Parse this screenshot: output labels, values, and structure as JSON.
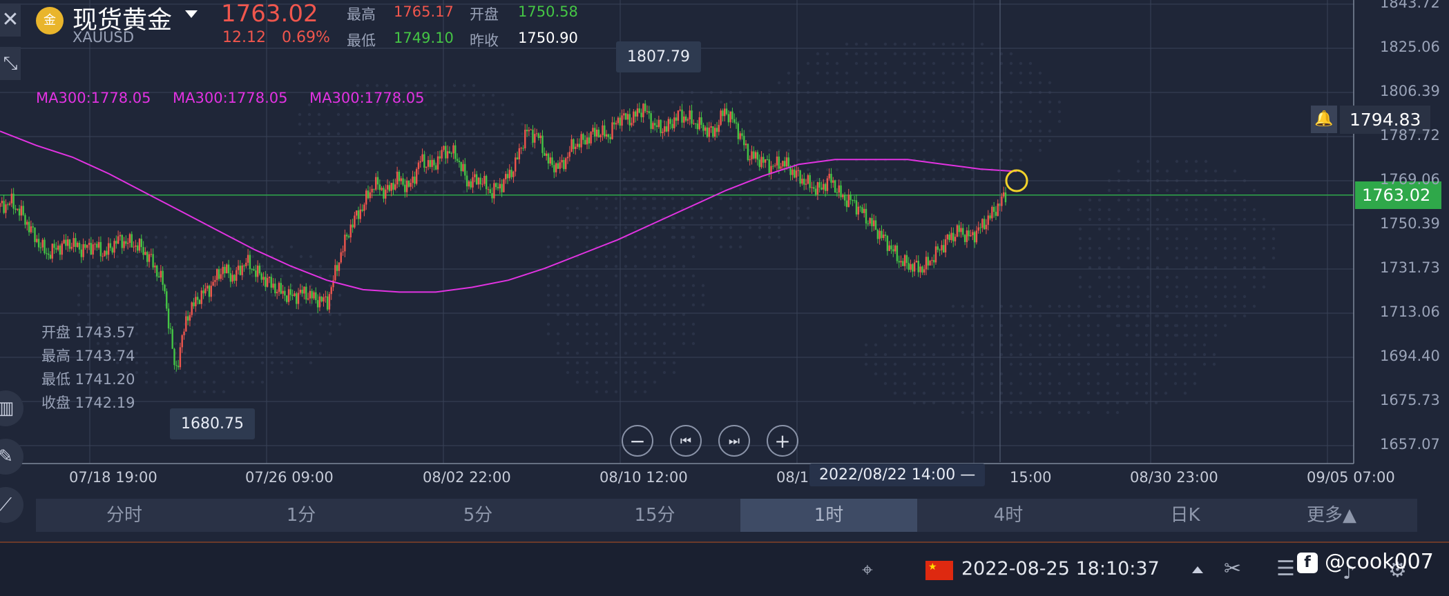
{
  "header": {
    "name": "现货黄金",
    "code": "XAUUSD",
    "price": "1763.02",
    "change": "12.12",
    "change_pct": "0.69%",
    "high_label": "最高",
    "high": "1765.17",
    "open_label": "开盘",
    "open": "1750.58",
    "low_label": "最低",
    "low": "1749.10",
    "prev_close_label": "昨收",
    "prev_close": "1750.90"
  },
  "ma_labels": [
    "MA300:1778.05",
    "MA300:1778.05",
    "MA300:1778.05"
  ],
  "ohlc_info": {
    "open": "开盘 1743.57",
    "high": "最高 1743.74",
    "low": "最低 1741.20",
    "close": "收盘 1742.19"
  },
  "callouts": {
    "max_price": "1807.79",
    "min_price": "1680.75",
    "current_price": "1763.02",
    "alert_price": "1794.83",
    "crosshair_time": "2022/08/22 14:00 —"
  },
  "y_ticks": [
    "1843.72",
    "1825.06",
    "1806.39",
    "1787.72",
    "1769.06",
    "1750.39",
    "1731.73",
    "1713.06",
    "1694.40",
    "1675.73",
    "1657.07"
  ],
  "x_ticks": [
    "07/18 19:00",
    "07/26 09:00",
    "08/02 22:00",
    "08/10 12:00",
    "08/1",
    "15:00",
    "08/30 23:00",
    "09/05 07:00"
  ],
  "chart_data": {
    "type": "candlestick",
    "interval": "1时",
    "ylim": [
      1657.07,
      1843.72
    ],
    "ma_period": 300,
    "ma_value": 1778.05,
    "max_marked": 1807.79,
    "min_marked": 1680.75,
    "last": 1763.02,
    "price_path": [
      1758,
      1760,
      1754,
      1745,
      1738,
      1741,
      1743,
      1740,
      1742,
      1738,
      1744,
      1743,
      1741,
      1735,
      1725,
      1688,
      1712,
      1720,
      1724,
      1732,
      1728,
      1735,
      1730,
      1726,
      1722,
      1720,
      1722,
      1719,
      1718,
      1736,
      1750,
      1758,
      1768,
      1764,
      1770,
      1766,
      1778,
      1775,
      1782,
      1780,
      1768,
      1770,
      1764,
      1768,
      1775,
      1790,
      1788,
      1776,
      1775,
      1784,
      1786,
      1790,
      1788,
      1796,
      1795,
      1800,
      1792,
      1791,
      1797,
      1795,
      1792,
      1789,
      1799,
      1792,
      1780,
      1778,
      1775,
      1777,
      1772,
      1768,
      1765,
      1770,
      1762,
      1760,
      1754,
      1748,
      1742,
      1735,
      1733,
      1732,
      1738,
      1744,
      1748,
      1745,
      1750,
      1756,
      1763
    ],
    "ma_path": [
      1790,
      1784,
      1779,
      1772,
      1764,
      1756,
      1748,
      1740,
      1733,
      1727,
      1723,
      1722,
      1722,
      1724,
      1727,
      1732,
      1738,
      1744,
      1751,
      1758,
      1765,
      1771,
      1776,
      1778,
      1778,
      1778,
      1776,
      1774,
      1773
    ]
  },
  "tabs": [
    "分时",
    "1分",
    "5分",
    "15分",
    "1时",
    "4时",
    "日K",
    "更多▲"
  ],
  "active_tab": "1时",
  "controls": {
    "zoom_out": "−",
    "prev": "⏮",
    "next": "⏭",
    "zoom_in": "+"
  },
  "status": {
    "datetime": "2022-08-25 18:10:37",
    "watermark": "@cook007"
  },
  "colors": {
    "background": "#1f2638",
    "up": "#f0564d",
    "down": "#45c545",
    "ma": "#e233e2",
    "last_price_line": "#2fa84a"
  },
  "icons": [
    "close-icon",
    "collapse-icon",
    "gold-coin-icon",
    "dropdown-arrow-icon",
    "bell-icon",
    "candlestick-icon",
    "pencil-icon",
    "indicator-icon",
    "cursor-icon",
    "china-flag-icon",
    "tools-icon",
    "list-icon",
    "facebook-icon",
    "sound-icon",
    "settings-icon"
  ]
}
